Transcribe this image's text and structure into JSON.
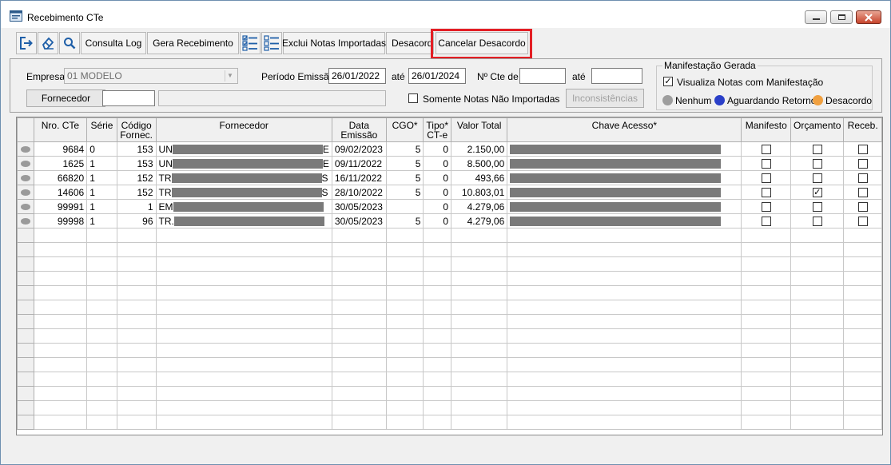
{
  "window": {
    "title": "Recebimento CTe"
  },
  "toolbar": {
    "consulta_log": "Consulta Log",
    "gera_recebimento": "Gera Recebimento",
    "exclui_notas": "Exclui Notas Importadas",
    "desacordo": "Desacordo",
    "cancelar_desacordo": "Cancelar Desacordo",
    "icons": [
      "exit-icon",
      "eraser-icon",
      "search-icon",
      "check-list-icon",
      "list-icon"
    ]
  },
  "filters": {
    "empresa_label": "Empresa",
    "empresa_value": "01 MODELO",
    "periodo_label": "Período Emissão",
    "periodo_de": "26/01/2022",
    "ate_label": "até",
    "periodo_ate": "26/01/2024",
    "nro_cte_label": "Nº Cte de",
    "nro_cte_de": "",
    "nro_cte_ate_label": "até",
    "nro_cte_ate": "",
    "fornecedor_button": "Fornecedor",
    "fornecedor_code": "",
    "fornecedor_name": "",
    "somente_label": "Somente Notas Não Importadas",
    "somente_checked": false,
    "inconsistencias_button": "Inconsistências"
  },
  "manifestacao": {
    "title": "Manifestação Gerada",
    "visualiza_label": "Visualiza Notas com Manifestação",
    "visualiza_checked": true,
    "legend": [
      {
        "label": "Nenhum",
        "color": "#9e9e9e"
      },
      {
        "label": "Aguardando Retorno",
        "color": "#2a3fc8"
      },
      {
        "label": "Desacordo",
        "color": "#f0a040"
      }
    ]
  },
  "grid": {
    "columns": [
      "Nro. CTe",
      "Série",
      "Código Fornec.",
      "Fornecedor",
      "Data Emissão",
      "CGO*",
      "Tipo* CT-e",
      "Valor Total",
      "Chave Acesso*",
      "Manifesto",
      "Orçamento",
      "Receb."
    ],
    "rows": [
      {
        "nro": "9684",
        "serie": "0",
        "codigo": "153",
        "fornecedor_prefix": "UN",
        "fornecedor_suffix": "E",
        "data": "09/02/2023",
        "cgo": "5",
        "tipo": "0",
        "valor": "2.150,00",
        "manifesto": false,
        "orcamento": false,
        "receb": false
      },
      {
        "nro": "1625",
        "serie": "1",
        "codigo": "153",
        "fornecedor_prefix": "UN",
        "fornecedor_suffix": "E",
        "data": "09/11/2022",
        "cgo": "5",
        "tipo": "0",
        "valor": "8.500,00",
        "manifesto": false,
        "orcamento": false,
        "receb": false
      },
      {
        "nro": "66820",
        "serie": "1",
        "codigo": "152",
        "fornecedor_prefix": "TR",
        "fornecedor_suffix": "S",
        "data": "16/11/2022",
        "cgo": "5",
        "tipo": "0",
        "valor": "493,66",
        "manifesto": false,
        "orcamento": false,
        "receb": false
      },
      {
        "nro": "14606",
        "serie": "1",
        "codigo": "152",
        "fornecedor_prefix": "TR",
        "fornecedor_suffix": "S",
        "data": "28/10/2022",
        "cgo": "5",
        "tipo": "0",
        "valor": "10.803,01",
        "manifesto": false,
        "orcamento": true,
        "receb": false
      },
      {
        "nro": "99991",
        "serie": "1",
        "codigo": "1",
        "fornecedor_prefix": "EM",
        "fornecedor_suffix": "",
        "data": "30/05/2023",
        "cgo": "",
        "tipo": "0",
        "valor": "4.279,06",
        "manifesto": false,
        "orcamento": false,
        "receb": false
      },
      {
        "nro": "99998",
        "serie": "1",
        "codigo": "96",
        "fornecedor_prefix": "TR.",
        "fornecedor_suffix": "",
        "data": "30/05/2023",
        "cgo": "5",
        "tipo": "0",
        "valor": "4.279,06",
        "manifesto": false,
        "orcamento": false,
        "receb": false
      }
    ],
    "empty_rows": 14
  }
}
